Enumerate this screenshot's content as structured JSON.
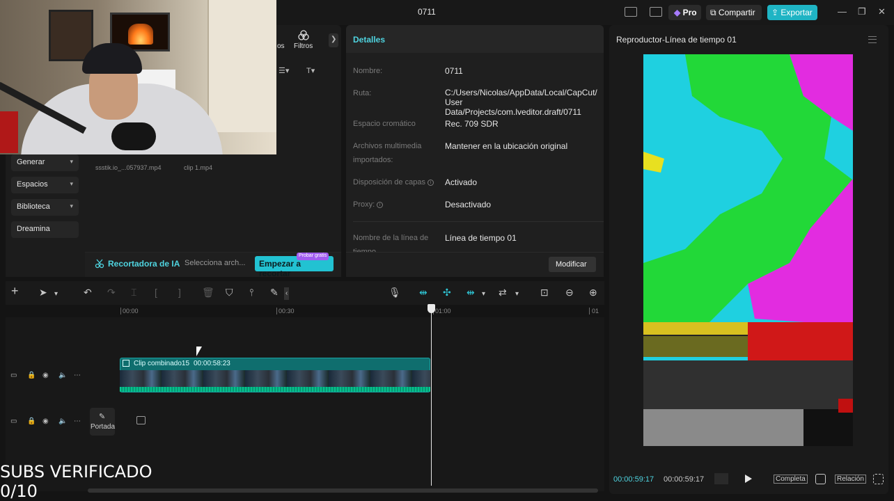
{
  "window": {
    "title": "0711",
    "pro_label": "Pro",
    "share_label": "Compartir",
    "export_label": "Exportar",
    "accent_color": "#22c2d2"
  },
  "media_panel": {
    "tab_partial": "os",
    "filters_label": "Filtros",
    "files": [
      {
        "name": "ssstik.io_...057937.mp4"
      },
      {
        "name": "clip 1.mp4"
      }
    ],
    "sidebar": [
      {
        "label": "Generar"
      },
      {
        "label": "Espacios"
      },
      {
        "label": "Biblioteca"
      },
      {
        "label": "Dreamina"
      }
    ],
    "ai_cutter": {
      "label": "Recortadora de IA",
      "select_label": "Selecciona arch...",
      "button_label": "Empezar a recortar",
      "badge": "Probar gratis"
    }
  },
  "details": {
    "title": "Detalles",
    "rows": [
      {
        "key": "Nombre:",
        "value": "0711"
      },
      {
        "key": "Ruta:",
        "value": "C:/Users/Nicolas/AppData/Local/CapCut/\nUser Data/Projects/com.lveditor.draft/0711"
      },
      {
        "key": "Espacio cromático",
        "value": "Rec. 709 SDR"
      },
      {
        "key": "Archivos multimedia importados:",
        "value": "Mantener en la ubicación original"
      },
      {
        "key": "Disposición de capas",
        "value": "Activado"
      },
      {
        "key": "Proxy:",
        "value": "Desactivado"
      },
      {
        "key": "Nombre de la línea de tiempo",
        "value": "Línea de tiempo 01"
      }
    ],
    "modify_label": "Modificar"
  },
  "player": {
    "title": "Reproductor-Línea de tiempo 01",
    "current_time": "00:00:59:17",
    "total_time": "00:00:59:17",
    "full_label": "Completa",
    "ratio_label": "Relación"
  },
  "timeline": {
    "ticks": [
      {
        "label": "00:00"
      },
      {
        "label": "00:30"
      },
      {
        "label": "01:00"
      },
      {
        "label": "01"
      }
    ],
    "clip": {
      "name": "Clip combinado15",
      "duration": "00:00:58:23"
    },
    "cover_label": "Portada"
  },
  "overlay": {
    "line1": "SUBS VERIFICADO",
    "line2": "0/10"
  }
}
